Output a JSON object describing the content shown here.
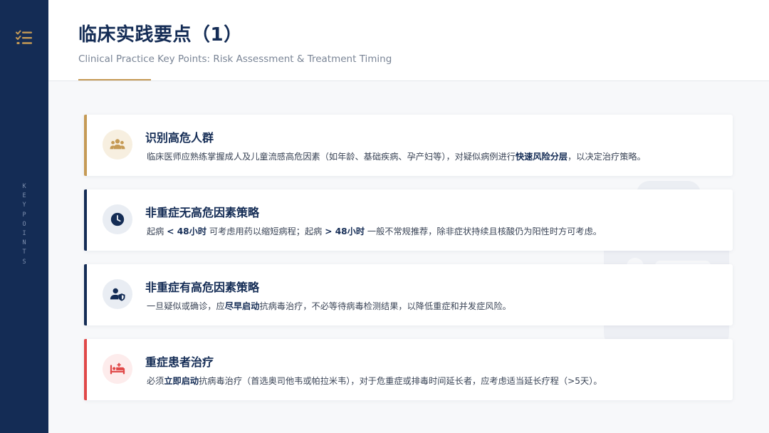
{
  "sidebar": {
    "icon": "checklist-icon",
    "vertical_label": [
      "K",
      "E",
      "Y",
      "P",
      "O",
      "I",
      "N",
      "T",
      "S"
    ],
    "color": "#142c55"
  },
  "header": {
    "title": "临床实践要点（1）",
    "subtitle": "Clinical Practice Key Points: Risk Assessment & Treatment Timing",
    "accent_color": "#c59a55"
  },
  "cards": [
    {
      "title": "识别高危人群",
      "icon": "group-people-icon",
      "accent": "#c59a55",
      "segments": [
        {
          "t": "临床医师应熟练掌握成人及儿童流感高危因素（如年龄、基础疾病、孕产妇等），对疑似病例进行",
          "b": false
        },
        {
          "t": "快速风险分层",
          "b": true
        },
        {
          "t": "，以决定治疗策略。",
          "b": false
        }
      ]
    },
    {
      "title": "非重症无高危因素策略",
      "icon": "clock-icon",
      "accent": "#142c55",
      "segments": [
        {
          "t": "起病 ",
          "b": false
        },
        {
          "t": "< 48小时",
          "b": true
        },
        {
          "t": " 可考虑用药以缩短病程；起病 ",
          "b": false
        },
        {
          "t": "> 48小时",
          "b": true
        },
        {
          "t": " 一般不常规推荐，除非症状持续且核酸仍为阳性时方可考虑。",
          "b": false
        }
      ]
    },
    {
      "title": "非重症有高危因素策略",
      "icon": "user-shield-icon",
      "accent": "#142c55",
      "segments": [
        {
          "t": "一旦疑似或确诊，应",
          "b": false
        },
        {
          "t": "尽早启动",
          "b": true
        },
        {
          "t": "抗病毒治疗，不必等待病毒检测结果，以降低重症和并发症风险。",
          "b": false
        }
      ]
    },
    {
      "title": "重症患者治疗",
      "icon": "hospital-bed-icon",
      "accent": "#e04848",
      "segments": [
        {
          "t": "必须",
          "b": false
        },
        {
          "t": "立即启动",
          "b": true
        },
        {
          "t": "抗病毒治疗（首选奥司他韦或帕拉米韦），对于危重症或排毒时间延长者，应考虑适当延长疗程（>5天）。",
          "b": false
        }
      ]
    }
  ]
}
